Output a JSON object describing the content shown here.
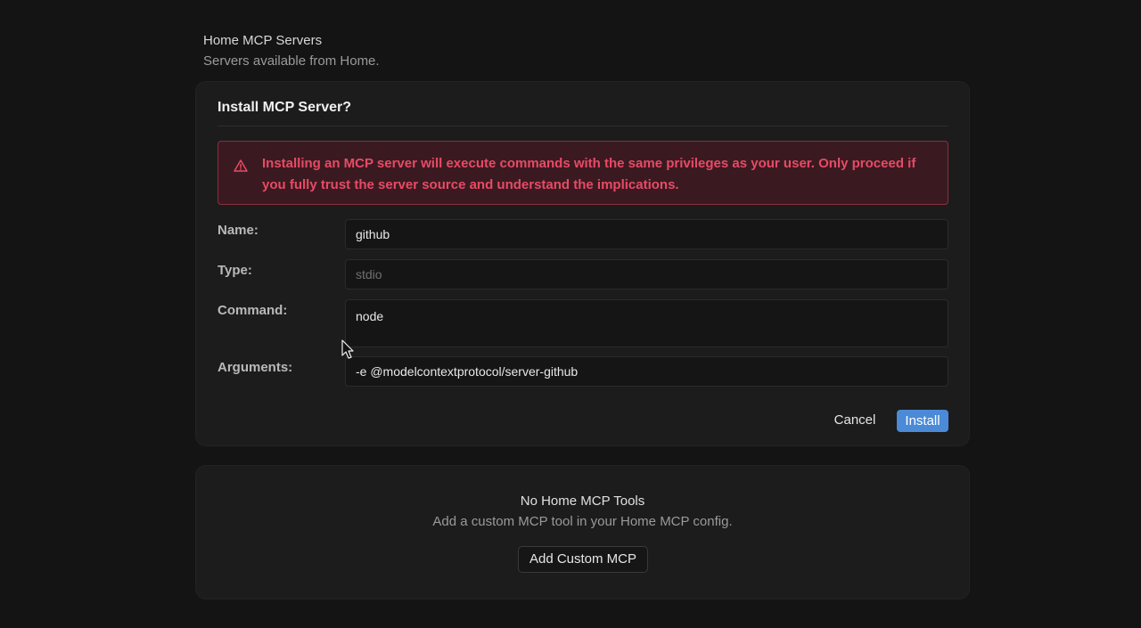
{
  "section": {
    "title": "Home MCP Servers",
    "subtitle": "Servers available from Home."
  },
  "dialog": {
    "title": "Install MCP Server?",
    "warning": {
      "icon": "warning-triangle-icon",
      "text": "Installing an MCP server will execute commands with the same privileges as your user. Only proceed if you fully trust the server source and understand the implications."
    },
    "fields": {
      "name": {
        "label": "Name:",
        "value": "github"
      },
      "type": {
        "label": "Type:",
        "value": "stdio"
      },
      "command": {
        "label": "Command:",
        "value": "node"
      },
      "arguments": {
        "label": "Arguments:",
        "value": "-e @modelcontextprotocol/server-github"
      }
    },
    "cancel_label": "Cancel",
    "install_label": "Install"
  },
  "empty_state": {
    "title": "No Home MCP Tools",
    "subtitle": "Add a custom MCP tool in your Home MCP config.",
    "button_label": "Add Custom MCP"
  },
  "colors": {
    "accent": "#4a8ad6",
    "warning_text": "#e84a66",
    "warning_bg": "#3a1a20",
    "background": "#141414"
  }
}
